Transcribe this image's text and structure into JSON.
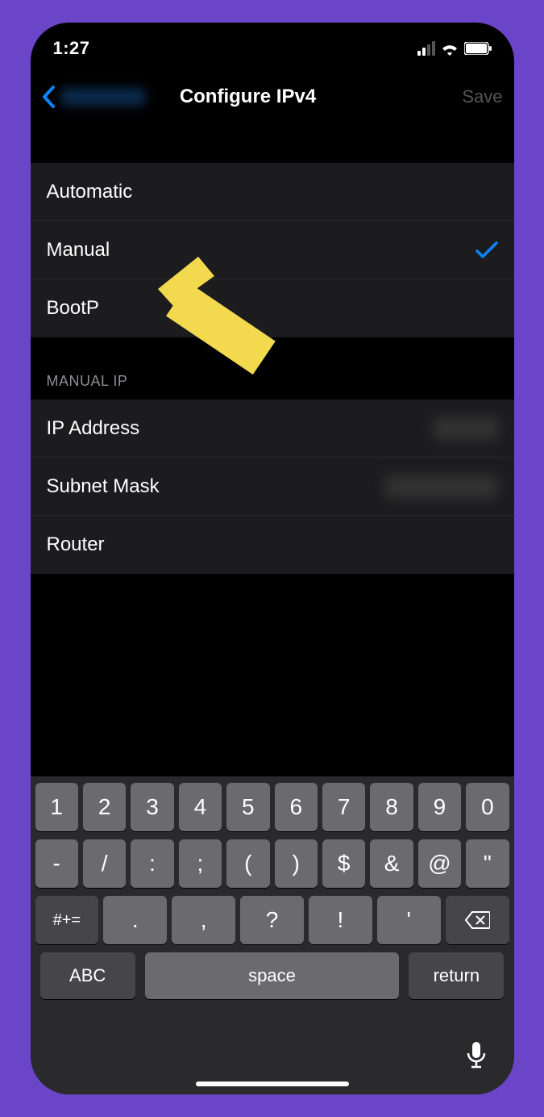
{
  "statusbar": {
    "time": "1:27"
  },
  "navbar": {
    "title": "Configure IPv4",
    "save": "Save"
  },
  "options": {
    "automatic": "Automatic",
    "manual": "Manual",
    "bootp": "BootP",
    "selected": "manual"
  },
  "sectionHeader": "MANUAL IP",
  "fields": {
    "ip": "IP Address",
    "subnet": "Subnet Mask",
    "router": "Router"
  },
  "keyboard": {
    "row1": [
      "1",
      "2",
      "3",
      "4",
      "5",
      "6",
      "7",
      "8",
      "9",
      "0"
    ],
    "row2": [
      "-",
      "/",
      ":",
      ";",
      "(",
      ")",
      "$",
      "&",
      "@",
      "\""
    ],
    "row3_sym": "#+=",
    "row3": [
      ".",
      ",",
      "?",
      "!",
      "'"
    ],
    "abc": "ABC",
    "space": "space",
    "return": "return"
  }
}
